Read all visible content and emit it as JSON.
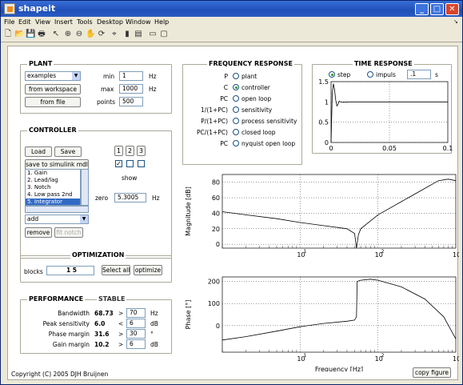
{
  "window": {
    "title": "shapeit"
  },
  "menu": [
    "File",
    "Edit",
    "View",
    "Insert",
    "Tools",
    "Desktop",
    "Window",
    "Help"
  ],
  "plant": {
    "title": "PLANT",
    "select": "examples",
    "from_workspace": "from workspace",
    "from_file": "from file",
    "min_label": "min",
    "min_value": "1",
    "min_unit": "Hz",
    "max_label": "max",
    "max_value": "1000",
    "max_unit": "Hz",
    "points_label": "points",
    "points_value": "500"
  },
  "controller": {
    "title": "CONTROLLER",
    "load": "Load",
    "save": "Save",
    "save_simulink": "save to simulink mdl",
    "list": [
      "1. Gain",
      "2. Lead/lag",
      "3. Notch",
      "4. Low pass 2nd",
      "5. Integrator"
    ],
    "selected_index": 4,
    "nums": [
      "1",
      "2",
      "3"
    ],
    "show": "show",
    "zero_label": "zero",
    "zero_value": "5.3005",
    "zero_unit": "Hz",
    "add_select": "add",
    "remove": "remove",
    "fit_notch": "fit notch"
  },
  "optimization": {
    "title": "OPTIMIZATION",
    "blocks_label": "blocks",
    "blocks_value": "1 5",
    "select_all": "Select all",
    "optimize": "optimize"
  },
  "performance": {
    "title": "PERFORMANCE",
    "status": "STABLE",
    "rows": [
      {
        "label": "Bandwidth",
        "value": "68.73",
        "op": ">",
        "target": "70",
        "unit": "Hz"
      },
      {
        "label": "Peak sensitivity",
        "value": "6.0",
        "op": "<",
        "target": "6",
        "unit": "dB"
      },
      {
        "label": "Phase margin",
        "value": "31.6",
        "op": ">",
        "target": "30",
        "unit": "°"
      },
      {
        "label": "Gain margin",
        "value": "10.2",
        "op": ">",
        "target": "6",
        "unit": "dB"
      }
    ]
  },
  "copyright": "Copyright (C) 2005  DJH Bruijnen",
  "freq_response": {
    "title": "FREQUENCY RESPONSE",
    "rows": [
      {
        "key": "P",
        "label": "plant",
        "on": false
      },
      {
        "key": "C",
        "label": "controller",
        "on": true
      },
      {
        "key": "PC",
        "label": "open loop",
        "on": false
      },
      {
        "key": "1/(1+PC)",
        "label": "sensitivity",
        "on": false
      },
      {
        "key": "P/(1+PC)",
        "label": "process sensitivity",
        "on": false
      },
      {
        "key": "PC/(1+PC)",
        "label": "closed loop",
        "on": false
      },
      {
        "key": "PC",
        "label": "nyquist open loop",
        "on": false
      }
    ]
  },
  "time_response": {
    "title": "TIME RESPONSE",
    "step": "step",
    "impulse": "impuls",
    "time_value": ".1",
    "time_unit": "s"
  },
  "copy_figure": "copy figure",
  "chart_data": [
    {
      "type": "line",
      "title": "",
      "xlabel": "",
      "ylabel": "",
      "xlim": [
        0,
        0.1
      ],
      "ylim": [
        0,
        1.5
      ],
      "xticks": [
        "0",
        "0.05",
        "0.1"
      ],
      "yticks": [
        "0",
        "0.5",
        "1",
        "1.5"
      ],
      "series": [
        {
          "x": [
            0,
            0.001,
            0.002,
            0.003,
            0.004,
            0.005,
            0.006,
            0.007,
            0.008,
            0.01,
            0.015,
            0.02,
            0.05,
            0.1
          ],
          "y": [
            0,
            1.2,
            1.45,
            1.3,
            1.05,
            0.9,
            0.95,
            1.02,
            1.0,
            0.99,
            1.0,
            1.0,
            1.0,
            1.0
          ]
        }
      ]
    },
    {
      "type": "line",
      "title": "",
      "xlabel": "",
      "ylabel": "Magnitude [dB]",
      "xscale": "log",
      "xlim": [
        1,
        1000
      ],
      "ylim": [
        -5,
        90
      ],
      "yticks": [
        "0",
        "20",
        "40",
        "60",
        "80"
      ],
      "series": [
        {
          "x": [
            1,
            2,
            5,
            10,
            20,
            40,
            50,
            53,
            56,
            60,
            80,
            100,
            200,
            400,
            600,
            800,
            1000
          ],
          "y": [
            42,
            38,
            33,
            28,
            24,
            20,
            14,
            -5,
            12,
            20,
            30,
            38,
            55,
            72,
            82,
            84,
            82
          ]
        }
      ]
    },
    {
      "type": "line",
      "title": "",
      "xlabel": "Frequency [Hz]",
      "ylabel": "Phase [°]",
      "xscale": "log",
      "xlim": [
        1,
        1000
      ],
      "ylim": [
        -120,
        220
      ],
      "yticks": [
        "0",
        "100",
        "200"
      ],
      "series": [
        {
          "x": [
            1,
            2,
            5,
            10,
            20,
            40,
            50,
            53,
            54,
            60,
            80,
            100,
            200,
            400,
            700,
            1000
          ],
          "y": [
            -65,
            -50,
            -25,
            -5,
            10,
            20,
            25,
            40,
            200,
            205,
            210,
            205,
            175,
            120,
            40,
            -60
          ]
        }
      ]
    }
  ]
}
